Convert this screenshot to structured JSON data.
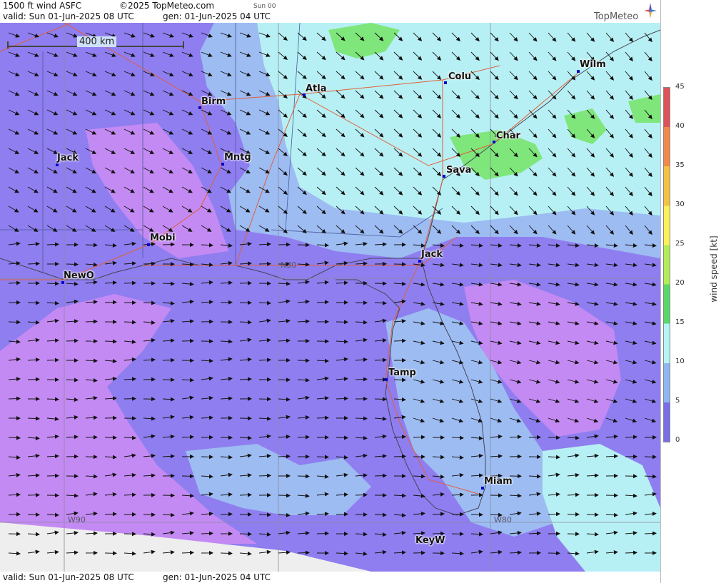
{
  "header": {
    "product": "1500 ft wind ASFC",
    "copyright": "©2025 TopMeteo.com",
    "run": "Sun 00",
    "valid": "valid:  Sun  01-Jun-2025  08 UTC",
    "gen": "gen: 01-Jun-2025 04 UTC",
    "logo_text": "TopMeteo"
  },
  "footer": {
    "valid": "valid:  Sun  01-Jun-2025  08 UTC",
    "gen": "gen: 01-Jun-2025 04 UTC"
  },
  "scale": {
    "label": "400 km"
  },
  "grid_labels": {
    "lat": "N30",
    "lon_west": "W90",
    "lon_east": "W80"
  },
  "cities": [
    {
      "name": "Birm"
    },
    {
      "name": "Atla"
    },
    {
      "name": "Colu"
    },
    {
      "name": "Wilm"
    },
    {
      "name": "Char"
    },
    {
      "name": "Jack"
    },
    {
      "name": "Mntg"
    },
    {
      "name": "Sava"
    },
    {
      "name": "Mobi"
    },
    {
      "name": "Jack"
    },
    {
      "name": "NewO"
    },
    {
      "name": "Tamp"
    },
    {
      "name": "Miam"
    },
    {
      "name": "KeyW"
    }
  ],
  "legend": {
    "unit": "wind speed [kt]",
    "ticks": [
      "45",
      "40",
      "35",
      "30",
      "25",
      "20",
      "15",
      "10",
      "5",
      "0"
    ],
    "colors": [
      "#e0525a",
      "#ef8a4a",
      "#f2c244",
      "#fbf15a",
      "#b2ec5a",
      "#58d86a",
      "#b6f3f3",
      "#8fb6ef",
      "#7a6ee8",
      "#c48af3"
    ]
  },
  "colors": {
    "calm": "#c48af3",
    "light": "#8f7ef0",
    "moderate": "#9dbcf2",
    "fresh": "#b7f0f4",
    "strong": "#7ee67a",
    "nodata": "#eeeeee"
  }
}
